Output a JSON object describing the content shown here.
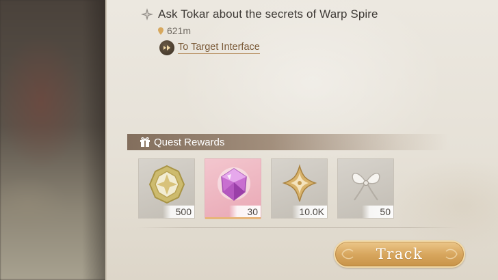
{
  "quest": {
    "title": "Ask Tokar about the secrets of Warp Spire",
    "distance": "621m",
    "target_link": "To Target Interface"
  },
  "rewards": {
    "header": "Quest Rewards",
    "items": [
      {
        "icon": "gold-diamond-emblem-icon",
        "quantity": "500"
      },
      {
        "icon": "pink-crystal-icon",
        "quantity": "30"
      },
      {
        "icon": "gold-star-petal-icon",
        "quantity": "10.0K"
      },
      {
        "icon": "white-ribbon-bow-icon",
        "quantity": "50"
      }
    ]
  },
  "actions": {
    "track_label": "Track"
  },
  "colors": {
    "panel": "#e9e5dd",
    "header_bar": "#7d6856",
    "track_button": "#d8a75f",
    "link": "#7a5a38",
    "pink_card": "#f0b9c3"
  }
}
